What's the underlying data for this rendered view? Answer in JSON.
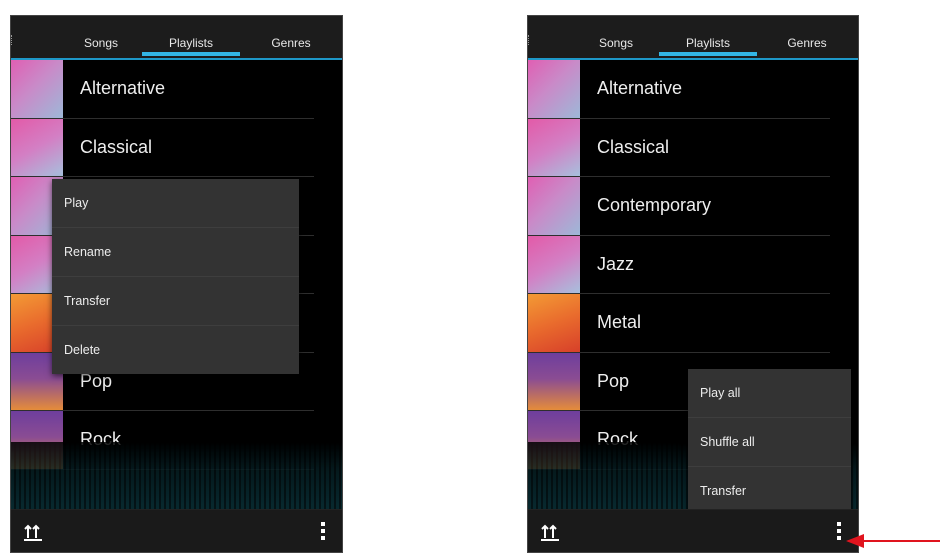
{
  "left_screen": {
    "tabs": [
      {
        "label": "Songs"
      },
      {
        "label": "Playlists"
      },
      {
        "label": "Genres"
      }
    ],
    "active_tab": "Playlists",
    "playlists": [
      {
        "label": "Alternative",
        "thumb": "pink"
      },
      {
        "label": "Classical",
        "thumb": "pink"
      },
      {
        "label": "",
        "thumb": "pink"
      },
      {
        "label": "",
        "thumb": "pink"
      },
      {
        "label": "",
        "thumb": "orange"
      },
      {
        "label": "Pop",
        "thumb": "purple"
      },
      {
        "label": "Rock",
        "thumb": "purple"
      }
    ],
    "context_menu": {
      "items": [
        "Play",
        "Rename",
        "Transfer",
        "Delete"
      ]
    },
    "bottom_bar": {
      "left_icon": "sort-icon",
      "right_icon": "overflow-menu-icon"
    }
  },
  "right_screen": {
    "tabs": [
      {
        "label": "Songs"
      },
      {
        "label": "Playlists"
      },
      {
        "label": "Genres"
      }
    ],
    "active_tab": "Playlists",
    "playlists": [
      {
        "label": "Alternative",
        "thumb": "pink"
      },
      {
        "label": "Classical",
        "thumb": "pink"
      },
      {
        "label": "Contemporary",
        "thumb": "pink"
      },
      {
        "label": "Jazz",
        "thumb": "pink"
      },
      {
        "label": "Metal",
        "thumb": "orange"
      },
      {
        "label": "Pop",
        "thumb": "purple"
      },
      {
        "label": "Rock",
        "thumb": "purple"
      }
    ],
    "overflow_menu": {
      "items": [
        "Play all",
        "Shuffle all",
        "Transfer"
      ]
    },
    "bottom_bar": {
      "left_icon": "sort-icon",
      "right_icon": "overflow-menu-icon"
    }
  },
  "annotation": {
    "arrow_color": "#e0141e",
    "points_to": "overflow-menu-icon"
  },
  "colors": {
    "accent": "#33b5e5",
    "background": "#000000",
    "menu_background": "#333333"
  }
}
